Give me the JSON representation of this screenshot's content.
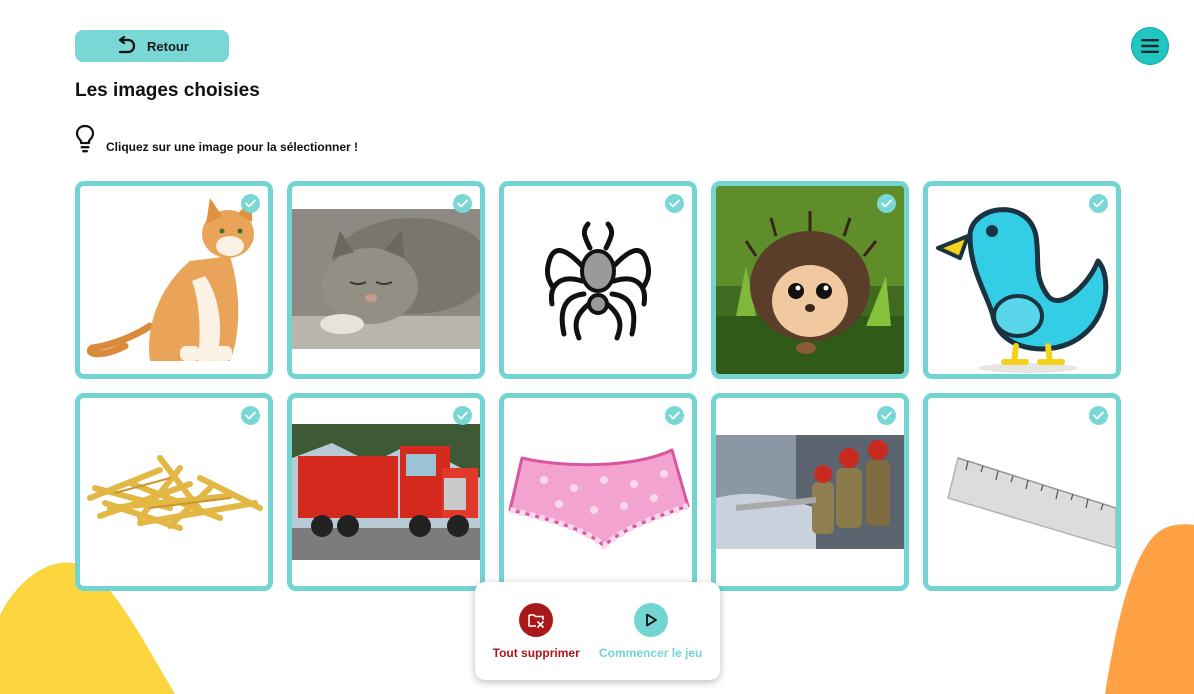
{
  "header": {
    "back_label": "Retour",
    "back_icon": "undo-arrow-icon",
    "menu_icon": "hamburger-menu-icon"
  },
  "page": {
    "title": "Les images choisies",
    "hint": "Cliquez sur une image pour la sélectionner !",
    "hint_icon": "lightbulb-icon"
  },
  "cards": [
    {
      "subject": "cat-sitting",
      "selected": true
    },
    {
      "subject": "cat-sleeping",
      "selected": true
    },
    {
      "subject": "spider",
      "selected": true
    },
    {
      "subject": "hedgehog",
      "selected": true
    },
    {
      "subject": "blue-bird",
      "selected": true
    },
    {
      "subject": "french-fries",
      "selected": true
    },
    {
      "subject": "red-truck",
      "selected": true
    },
    {
      "subject": "pink-underwear",
      "selected": true
    },
    {
      "subject": "firefighters",
      "selected": true
    },
    {
      "subject": "ruler",
      "selected": true
    }
  ],
  "actions": {
    "delete_label": "Tout supprimer",
    "start_label": "Commencer le jeu"
  },
  "colors": {
    "accent": "#72d5d2",
    "menu": "#21c6c0",
    "danger": "#a91818",
    "blob_yellow": "#fcd53f",
    "blob_orange": "#ffa246"
  }
}
